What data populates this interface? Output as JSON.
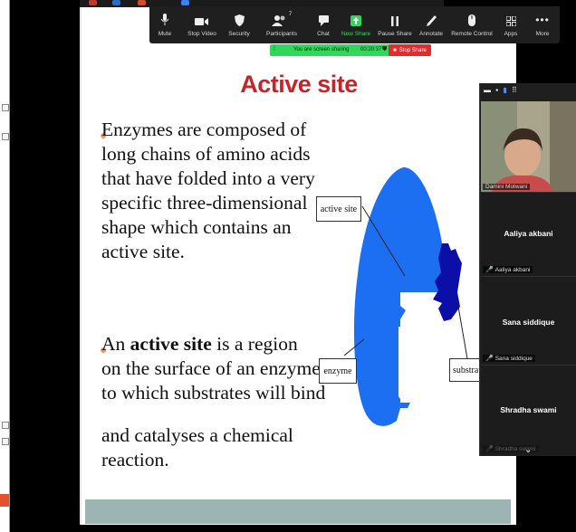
{
  "toolbar": {
    "items": [
      {
        "label": "Mute",
        "icon": "microphone-icon"
      },
      {
        "label": "Stop Video",
        "icon": "video-camera-icon"
      },
      {
        "label": "Security",
        "icon": "shield-icon"
      },
      {
        "label": "Participants",
        "icon": "participants-icon",
        "badge": "7"
      },
      {
        "label": "Chat",
        "icon": "chat-icon"
      },
      {
        "label": "New Share",
        "icon": "share-screen-icon"
      },
      {
        "label": "Pause Share",
        "icon": "pause-icon"
      },
      {
        "label": "Annotate",
        "icon": "pen-icon"
      },
      {
        "label": "Remote Control",
        "icon": "mouse-icon"
      },
      {
        "label": "Apps",
        "icon": "apps-icon"
      },
      {
        "label": "More",
        "icon": "more-icon"
      }
    ],
    "accent": "#2fd85b"
  },
  "sharebar": {
    "text": "You are screen sharing",
    "timer": "00:20:37",
    "stop_label": "Stop Share"
  },
  "slide": {
    "title": "Active site",
    "bullet1": "Enzymes are composed of\nlong chains of amino acids\nthat have folded into a very\nspecific three-dimensional\nshape which contains an\nactive site.",
    "bullet2_pre": "An ",
    "bullet2_bold": "active site",
    "bullet2_post": " is a region\non the surface of an enzyme\nto which substrates will bind",
    "continuation": "and catalyses a chemical\nreaction.",
    "label_active": "active site",
    "label_enzyme": "enzyme",
    "label_substrate": "substrate",
    "title_color": "#c3262a"
  },
  "panel": {
    "participants": [
      {
        "name": "Damini Motwani",
        "video": true
      },
      {
        "name": "Aaliya akbani",
        "muted": true
      },
      {
        "name": "Sana siddique",
        "muted": true
      },
      {
        "name": "Shradha swami",
        "muted": true
      }
    ]
  }
}
